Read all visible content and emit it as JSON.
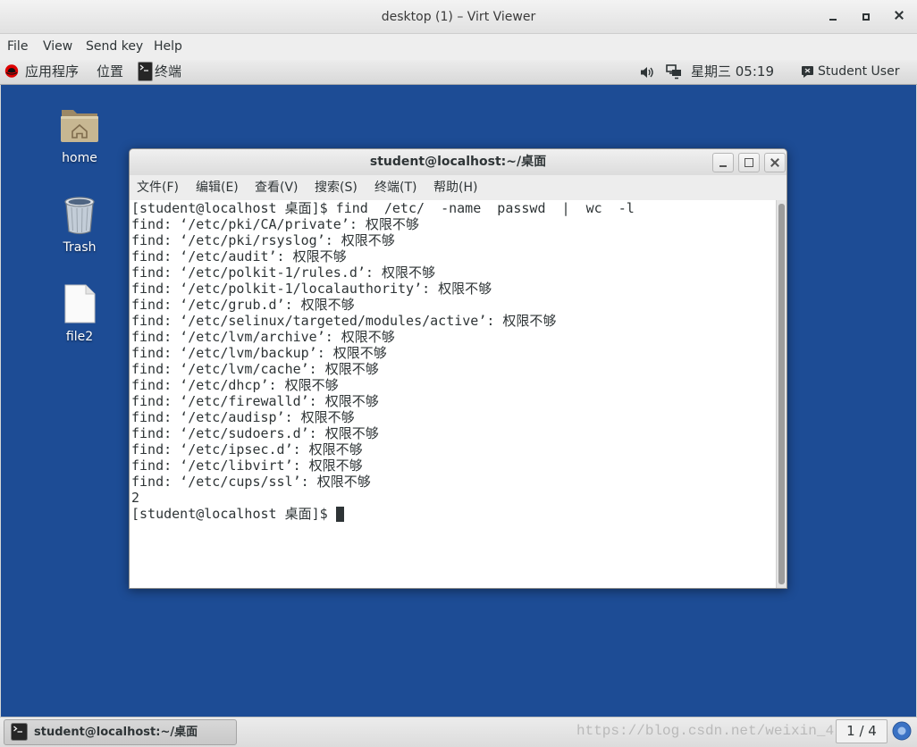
{
  "window": {
    "title": "desktop (1) – Virt Viewer",
    "controls": {
      "minimize": "minimize-icon",
      "maximize": "maximize-icon",
      "close": "close-icon"
    }
  },
  "menubar": {
    "file": "File",
    "view": "View",
    "send_key": "Send key",
    "help": "Help"
  },
  "top_panel": {
    "applications": "应用程序",
    "places": "位置",
    "active_app": "终端",
    "clock": "星期三 05:19",
    "user": "Student User",
    "icons": {
      "distro": "redhat-logo-icon",
      "active_app": "terminal-icon",
      "volume": "volume-icon",
      "network": "network-icon",
      "status": "chat-status-icon"
    }
  },
  "desktop": {
    "icons": [
      {
        "label": "home",
        "icon": "home-folder-icon"
      },
      {
        "label": "Trash",
        "icon": "trash-icon"
      },
      {
        "label": "file2",
        "icon": "file-icon"
      }
    ]
  },
  "terminal": {
    "title": "student@localhost:~/桌面",
    "menu": [
      "文件(F)",
      "编辑(E)",
      "查看(V)",
      "搜索(S)",
      "终端(T)",
      "帮助(H)"
    ],
    "lines": [
      "[student@localhost 桌面]$ find  /etc/  -name  passwd  |  wc  -l",
      "find: ‘/etc/pki/CA/private’: 权限不够",
      "find: ‘/etc/pki/rsyslog’: 权限不够",
      "find: ‘/etc/audit’: 权限不够",
      "find: ‘/etc/polkit-1/rules.d’: 权限不够",
      "find: ‘/etc/polkit-1/localauthority’: 权限不够",
      "find: ‘/etc/grub.d’: 权限不够",
      "find: ‘/etc/selinux/targeted/modules/active’: 权限不够",
      "find: ‘/etc/lvm/archive’: 权限不够",
      "find: ‘/etc/lvm/backup’: 权限不够",
      "find: ‘/etc/lvm/cache’: 权限不够",
      "find: ‘/etc/dhcp’: 权限不够",
      "find: ‘/etc/firewalld’: 权限不够",
      "find: ‘/etc/audisp’: 权限不够",
      "find: ‘/etc/sudoers.d’: 权限不够",
      "find: ‘/etc/ipsec.d’: 权限不够",
      "find: ‘/etc/libvirt’: 权限不够",
      "find: ‘/etc/cups/ssl’: 权限不够",
      "2"
    ],
    "prompt": "[student@localhost 桌面]$ "
  },
  "taskbar": {
    "window_button": "student@localhost:~/桌面",
    "window_icon": "terminal-icon",
    "workspace": "1 / 4",
    "notification_icon": "notification-icon"
  },
  "watermark": "https://blog.csdn.net/weixin_4",
  "colors": {
    "desktop_background": "#1d4c95",
    "terminal_text": "#2e3436",
    "ui_text": "#2e3436",
    "distro_red": "#dd0000",
    "notification_blue": "#3a72c4"
  }
}
